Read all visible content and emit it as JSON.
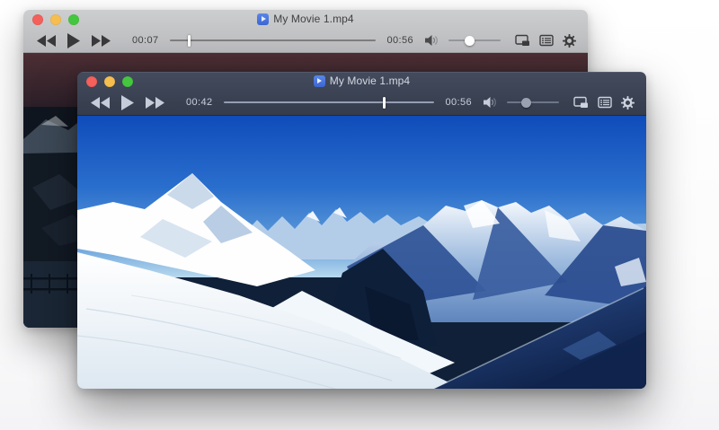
{
  "windows": {
    "back": {
      "title": "My Movie 1.mp4",
      "current_time": "00:07",
      "duration": "00:56",
      "progress_pct": "9.5%",
      "volume_pct": "40%",
      "theme": "light",
      "video_description": "dark dusk mountain scene with fence"
    },
    "front": {
      "title": "My Movie 1.mp4",
      "current_time": "00:42",
      "duration": "00:56",
      "progress_pct": "76%",
      "volume_pct": "37%",
      "theme": "dark",
      "video_description": "sunny snowy alpine mountains under blue sky"
    }
  },
  "icons": {
    "traffic_lights": [
      "close-button",
      "minimize-button",
      "zoom-button"
    ],
    "transport": [
      "rewind-icon",
      "play-icon",
      "fast-forward-icon"
    ],
    "volume": "speaker-icon",
    "right": [
      "picture-in-picture-icon",
      "media-list-icon",
      "gear-icon"
    ],
    "file": "movie-file-icon"
  },
  "colors": {
    "traffic_red": "#f4605a",
    "traffic_yellow": "#f6be4f",
    "traffic_green": "#45c63f",
    "front_titlebar": "#3c4455",
    "back_titlebar": "#c4c5c7",
    "sky_top": "#1150bd",
    "file_icon_blue": "#3c66cf"
  }
}
